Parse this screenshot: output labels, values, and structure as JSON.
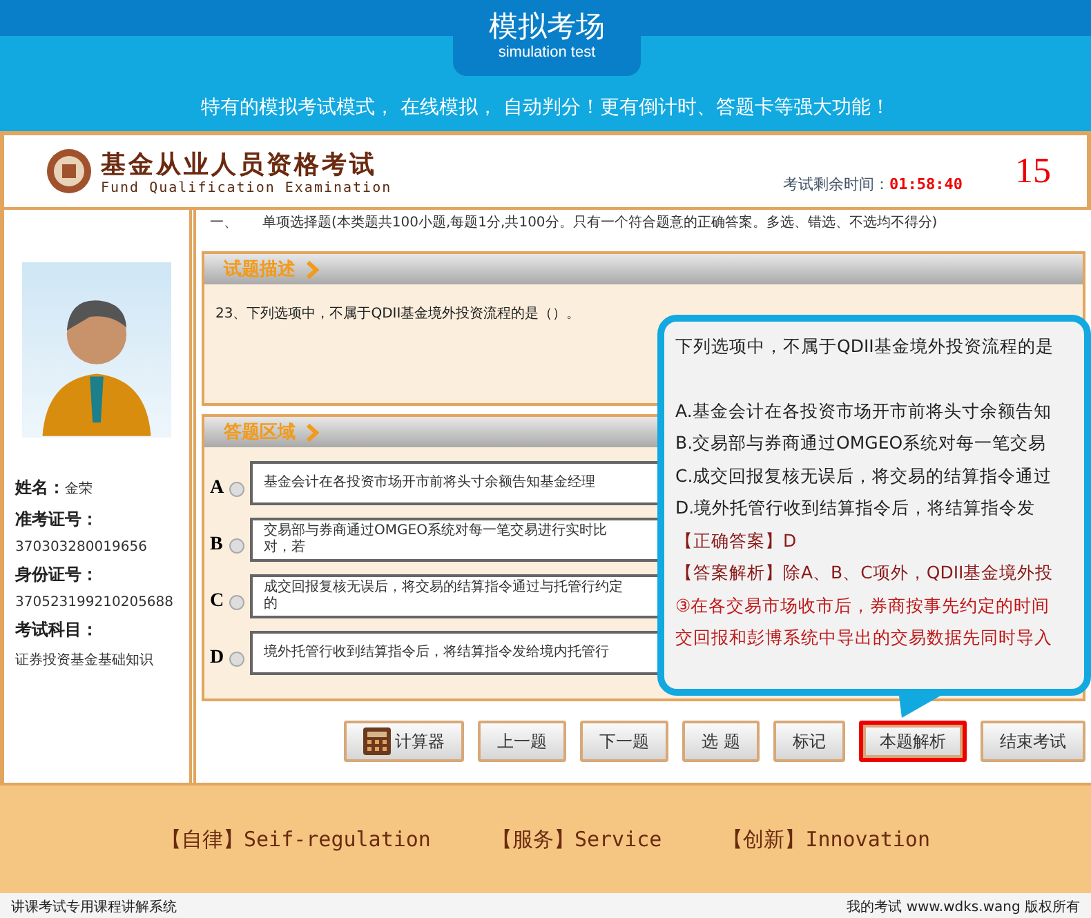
{
  "banner": {
    "title": "模拟考场",
    "subtitle": "simulation test",
    "tagline": "特有的模拟考试模式， 在线模拟， 自动判分！更有倒计时、答题卡等强大功能！"
  },
  "exam_header": {
    "title": "基金从业人员资格考试",
    "subtitle": "Fund  Qualification Examination",
    "timer_label": "考试剩余时间：",
    "timer": "01:58:40",
    "count": "15"
  },
  "candidate": [
    {
      "label": "姓名：",
      "value": "金荣"
    },
    {
      "label": "准考证号：",
      "value": "370303280019656"
    },
    {
      "label": "身份证号：",
      "value": "370523199210205688"
    },
    {
      "label": "考试科目：",
      "value": "证券投资基金基础知识"
    }
  ],
  "section": {
    "number": "一、",
    "text": "单项选择题(本类题共100小题,每题1分,共100分。只有一个符合题意的正确答案。多选、错选、不选均不得分)"
  },
  "question_panel": {
    "title": "试题描述",
    "question": "23、下列选项中，不属于QDII基金境外投资流程的是（）。"
  },
  "answer_panel": {
    "title": "答题区域",
    "options": [
      {
        "letter": "A",
        "text": "基金会计在各投资市场开市前将头寸余额告知基金经理",
        "selected": false
      },
      {
        "letter": "B",
        "text": "交易部与券商通过OMGEO系统对每一笔交易进行实时比对，若",
        "selected": false
      },
      {
        "letter": "C",
        "text": "成交回报复核无误后，将交易的结算指令通过与托管行约定的",
        "selected": false
      },
      {
        "letter": "D",
        "text": "境外托管行收到结算指令后，将结算指令发给境内托管行",
        "selected": false
      }
    ]
  },
  "buttons": [
    {
      "label": "计算器",
      "kind": "calculator",
      "highlighted": false
    },
    {
      "label": "上一题",
      "kind": "plain",
      "highlighted": false
    },
    {
      "label": "下一题",
      "kind": "plain",
      "highlighted": false
    },
    {
      "label": "选 题",
      "kind": "plain",
      "highlighted": false
    },
    {
      "label": "标记",
      "kind": "plain",
      "highlighted": false
    },
    {
      "label": "本题解析",
      "kind": "plain",
      "highlighted": true
    },
    {
      "label": "结束考试",
      "kind": "plain",
      "highlighted": false
    }
  ],
  "explanation_popup": {
    "lines": [
      {
        "text": "下列选项中，不属于QDII基金境外投资流程的是",
        "kind": "plain"
      },
      {
        "text": "A.基金会计在各投资市场开市前将头寸余额告知",
        "kind": "plain"
      },
      {
        "text": "B.交易部与券商通过OMGEO系统对每一笔交易",
        "kind": "plain"
      },
      {
        "text": "C.成交回报复核无误后，将交易的结算指令通过",
        "kind": "plain"
      },
      {
        "text": "D.境外托管行收到结算指令后，将结算指令发",
        "kind": "plain"
      },
      {
        "text": "【正确答案】D",
        "kind": "answer"
      },
      {
        "text": "【答案解析】除A、B、C项外，QDII基金境外投",
        "kind": "answer"
      },
      {
        "text": "③在各交易市场收市后，券商按事先约定的时间",
        "kind": "note"
      },
      {
        "text": "交回报和彭博系统中导出的交易数据先同时导入",
        "kind": "note"
      }
    ]
  },
  "footer": {
    "mottos": [
      "【自律】Seif-regulation",
      "【服务】Service",
      "【创新】Innovation"
    ]
  },
  "status_bar": {
    "left": "讲课考试专用课程讲解系统",
    "right": "我的考试 www.wdks.wang 版权所有"
  }
}
